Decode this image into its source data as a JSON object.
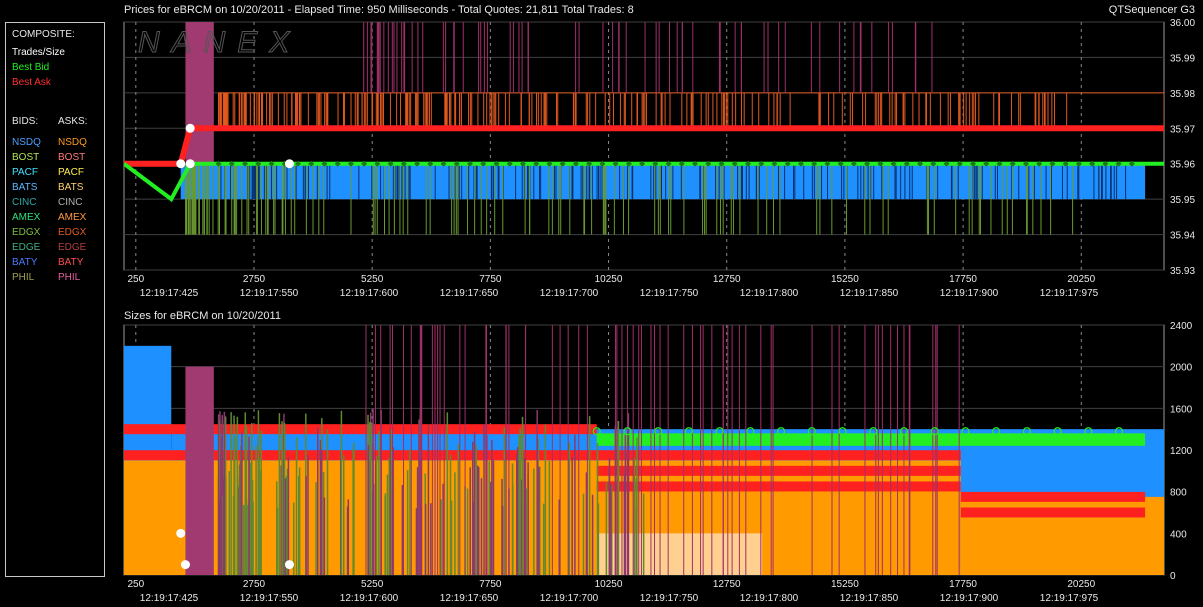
{
  "window": {
    "app_name": "QTSequencer G3",
    "watermark": "NANEX"
  },
  "legend": {
    "composite_header": "COMPOSITE:",
    "composite_items": [
      {
        "label": "Trades/Size",
        "color": "#ffffff"
      },
      {
        "label": "Best Bid",
        "color": "#22ee22"
      },
      {
        "label": "Best Ask",
        "color": "#ff3030"
      }
    ],
    "bids_header": "BIDS:",
    "asks_header": "ASKS:",
    "exchanges": [
      {
        "bid": "NSDQ",
        "ask": "NSDQ",
        "bid_color": "#4aa0ff",
        "ask_color": "#ff9a20"
      },
      {
        "bid": "BOST",
        "ask": "BOST",
        "bid_color": "#b0e05a",
        "ask_color": "#ff7a7a"
      },
      {
        "bid": "PACF",
        "ask": "PACF",
        "bid_color": "#40e0ff",
        "ask_color": "#ffee55"
      },
      {
        "bid": "BATS",
        "ask": "BATS",
        "bid_color": "#60b8ff",
        "ask_color": "#ffd070"
      },
      {
        "bid": "CINC",
        "ask": "CINC",
        "bid_color": "#2fa8a8",
        "ask_color": "#b0b0b0"
      },
      {
        "bid": "AMEX",
        "ask": "AMEX",
        "bid_color": "#30e080",
        "ask_color": "#ff9a40"
      },
      {
        "bid": "EDGX",
        "ask": "EDGX",
        "bid_color": "#7fbf3f",
        "ask_color": "#e05a20"
      },
      {
        "bid": "EDGE",
        "ask": "EDGE",
        "bid_color": "#40b080",
        "ask_color": "#b04040"
      },
      {
        "bid": "BATY",
        "ask": "BATY",
        "bid_color": "#4a7aff",
        "ask_color": "#ff5050"
      },
      {
        "bid": "PHIL",
        "ask": "PHIL",
        "bid_color": "#a0a050",
        "ask_color": "#e060a0"
      }
    ]
  },
  "chart_data": [
    {
      "type": "line",
      "title": "Prices for  eBRCM  on  10/20/2011  -  Elapsed Time: 950 Milliseconds  -  Total Quotes: 21,811  Total Trades: 8",
      "ylim": [
        35.93,
        36.0
      ],
      "y_ticks": [
        "36.00",
        "35.99",
        "35.98",
        "35.97",
        "35.96",
        "35.95",
        "35.94",
        "35.93"
      ],
      "x_ticks": [
        "250",
        "2750",
        "5250",
        "7750",
        "10250",
        "12750",
        "15250",
        "17750",
        "20250"
      ],
      "time_ticks": [
        "12:19:17:425",
        "12:19:17:550",
        "12:19:17:600",
        "12:19:17:650",
        "12:19:17:700",
        "12:19:17:750",
        "12:19:17:800",
        "12:19:17:850",
        "12:19:17:900",
        "12:19:17:975"
      ],
      "xlim": [
        0,
        22000
      ],
      "series": [
        {
          "name": "Best Ask",
          "color": "#ff2020",
          "x": [
            0,
            1200,
            1400,
            22000
          ],
          "y": [
            35.96,
            35.96,
            35.97,
            35.97
          ]
        },
        {
          "name": "Best Bid",
          "color": "#22ee22",
          "x": [
            0,
            1000,
            1400,
            22000
          ],
          "y": [
            35.96,
            35.95,
            35.96,
            35.96
          ]
        },
        {
          "name": "NSDQ",
          "color": "#1e90ff",
          "x": [
            1200,
            21600
          ],
          "y": [
            35.95,
            35.95
          ]
        },
        {
          "name": "EDGX",
          "color": "#e05a20",
          "x": [
            2000,
            22000
          ],
          "y": [
            35.98,
            35.98
          ]
        },
        {
          "name": "Trades/Size",
          "color": "#ffffff",
          "x": [
            1400,
            1200,
            1400,
            3500
          ],
          "y": [
            35.97,
            35.96,
            35.96,
            35.96
          ]
        }
      ]
    },
    {
      "type": "area",
      "title": "Sizes for  eBRCM  on  10/20/2011",
      "ylim": [
        0,
        2400
      ],
      "y_ticks": [
        "2400",
        "2000",
        "1600",
        "1200",
        "800",
        "400",
        "0"
      ],
      "x_ticks": [
        "250",
        "2750",
        "5250",
        "7750",
        "10250",
        "12750",
        "15250",
        "17750",
        "20250"
      ],
      "time_ticks": [
        "12:19:17:425",
        "12:19:17:550",
        "12:19:17:600",
        "12:19:17:650",
        "12:19:17:700",
        "12:19:17:750",
        "12:19:17:800",
        "12:19:17:850",
        "12:19:17:900",
        "12:19:17:975"
      ],
      "xlim": [
        0,
        22000
      ],
      "series": [
        {
          "name": "NSDQ",
          "color": "#1e90ff",
          "x": [
            0,
            1000,
            1000,
            10000,
            10000,
            22000
          ],
          "y": [
            2200,
            2200,
            1400,
            1400,
            1400,
            1400
          ]
        },
        {
          "name": "Best Bid",
          "color": "#22ee22",
          "x": [
            10000,
            21600
          ],
          "y": [
            1300,
            1300
          ]
        },
        {
          "name": "Best Ask",
          "color": "#ff2020",
          "x": [
            0,
            10000,
            10000,
            17700,
            17700,
            21600
          ],
          "y": [
            1400,
            1400,
            1200,
            1200,
            800,
            600
          ]
        },
        {
          "name": "BOST",
          "color": "#ff9a00",
          "x": [
            0,
            22000
          ],
          "y": [
            1100,
            1100
          ]
        },
        {
          "name": "Trades/Size",
          "color": "#ffffff",
          "x": [
            1200,
            1300,
            3500
          ],
          "y": [
            400,
            100,
            100
          ]
        }
      ]
    }
  ]
}
